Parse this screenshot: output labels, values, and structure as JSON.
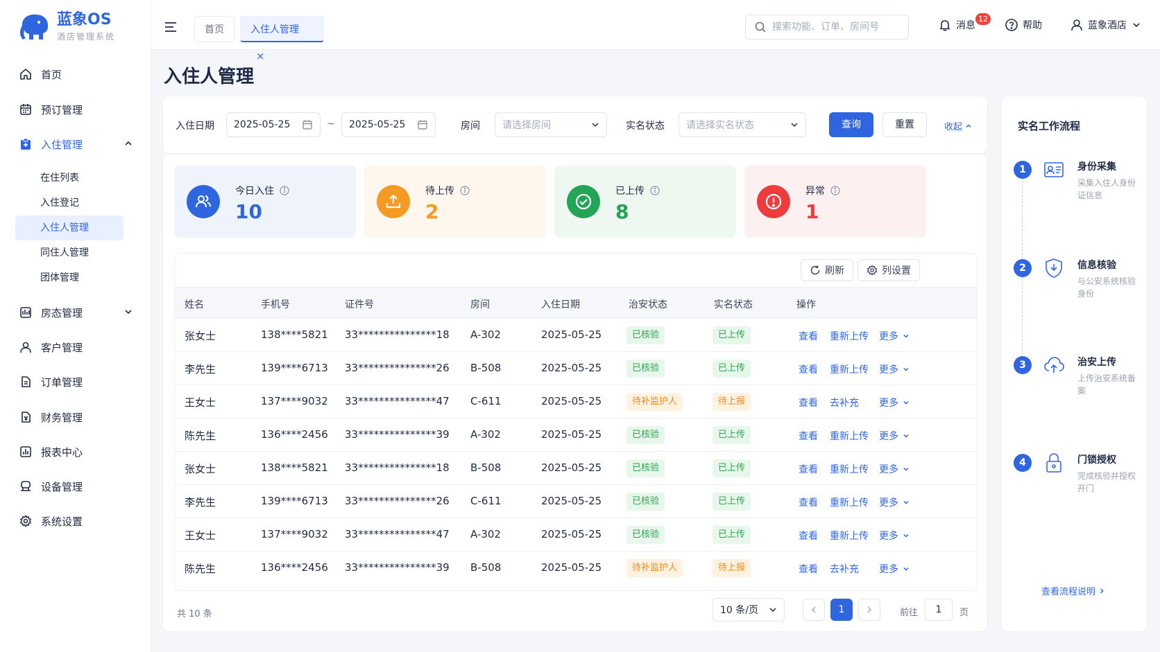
{
  "app": {
    "name": "蓝象OS",
    "subtitle": "酒店管理系统"
  },
  "sidebar": {
    "items": [
      {
        "label": "首页",
        "icon": "home-icon"
      },
      {
        "label": "预订管理",
        "icon": "calendar-icon"
      },
      {
        "label": "入住管理",
        "icon": "checkin-icon",
        "expanded": true
      },
      {
        "label": "房态管理",
        "icon": "room-icon"
      },
      {
        "label": "客户管理",
        "icon": "user-icon"
      },
      {
        "label": "订单管理",
        "icon": "order-icon"
      },
      {
        "label": "财务管理",
        "icon": "finance-icon"
      },
      {
        "label": "报表中心",
        "icon": "report-icon"
      },
      {
        "label": "设备管理",
        "icon": "device-icon"
      },
      {
        "label": "系统设置",
        "icon": "gear-icon"
      }
    ],
    "sub_items": [
      "在住列表",
      "入住登记",
      "入住人管理",
      "同住人管理",
      "团体管理"
    ],
    "active_sub": "入住人管理"
  },
  "topbar": {
    "tabs": [
      {
        "label": "首页"
      },
      {
        "label": "入住人管理",
        "active": true
      }
    ],
    "search_placeholder": "搜索功能、订单、房间号",
    "messages_label": "消息",
    "messages_count": "12",
    "help_label": "帮助",
    "user_label": "蓝象酒店"
  },
  "page": {
    "title": "入住人管理"
  },
  "filter": {
    "date_label": "入住日期",
    "date_start": "2025-05-25",
    "date_sep": "~",
    "date_end": "2025-05-25",
    "room_label": "房间",
    "room_placeholder": "请选择房间",
    "status_label": "实名状态",
    "status_placeholder": "请选择实名状态",
    "query_label": "查询",
    "reset_label": "重置",
    "collapse_label": "收起"
  },
  "stats": [
    {
      "label": "今日入住",
      "value": "10",
      "color": "#2f66e0",
      "bg": "#eef3fc",
      "icon": "users-icon"
    },
    {
      "label": "待上传",
      "value": "2",
      "color": "#f59a23",
      "bg": "#fff7ee",
      "icon": "upload-icon"
    },
    {
      "label": "已上传",
      "value": "8",
      "color": "#22a556",
      "bg": "#eef8f1",
      "icon": "check-circle-icon"
    },
    {
      "label": "异常",
      "value": "1",
      "color": "#ee3b3b",
      "bg": "#fdf0f0",
      "icon": "alert-icon"
    }
  ],
  "table": {
    "refresh_label": "刷新",
    "columns_label": "列设置",
    "headers": [
      "姓名",
      "手机号",
      "证件号",
      "房间",
      "入住日期",
      "治安状态",
      "实名状态",
      "操作"
    ],
    "rows": [
      {
        "name": "张女士",
        "phone": "138****5821",
        "id": "33***************18",
        "room": "A-302",
        "date": "2025-05-25",
        "security": "已核验",
        "realname": "已上传",
        "act2": "重新上传",
        "more": "更多",
        "view": "查看",
        "ok": true
      },
      {
        "name": "李先生",
        "phone": "139****6713",
        "id": "33***************26",
        "room": "B-508",
        "date": "2025-05-25",
        "security": "已核验",
        "realname": "已上传",
        "act2": "重新上传",
        "more": "更多",
        "view": "查看",
        "ok": true
      },
      {
        "name": "王女士",
        "phone": "137****9032",
        "id": "33***************47",
        "room": "C-611",
        "date": "2025-05-25",
        "security": "待补监护人",
        "realname": "待上报",
        "act2": "去补充",
        "more": "更多",
        "view": "查看",
        "ok": false
      },
      {
        "name": "陈先生",
        "phone": "136****2456",
        "id": "33***************39",
        "room": "A-302",
        "date": "2025-05-25",
        "security": "已核验",
        "realname": "已上传",
        "act2": "重新上传",
        "more": "更多",
        "view": "查看",
        "ok": true
      },
      {
        "name": "张女士",
        "phone": "138****5821",
        "id": "33***************18",
        "room": "B-508",
        "date": "2025-05-25",
        "security": "已核验",
        "realname": "已上传",
        "act2": "重新上传",
        "more": "更多",
        "view": "查看",
        "ok": true
      },
      {
        "name": "李先生",
        "phone": "139****6713",
        "id": "33***************26",
        "room": "C-611",
        "date": "2025-05-25",
        "security": "已核验",
        "realname": "已上传",
        "act2": "重新上传",
        "more": "更多",
        "view": "查看",
        "ok": true
      },
      {
        "name": "王女士",
        "phone": "137****9032",
        "id": "33***************47",
        "room": "A-302",
        "date": "2025-05-25",
        "security": "已核验",
        "realname": "已上传",
        "act2": "重新上传",
        "more": "更多",
        "view": "查看",
        "ok": true
      },
      {
        "name": "陈先生",
        "phone": "136****2456",
        "id": "33***************39",
        "room": "B-508",
        "date": "2025-05-25",
        "security": "待补监护人",
        "realname": "待上报",
        "act2": "去补充",
        "more": "更多",
        "view": "查看",
        "ok": false
      }
    ]
  },
  "pagination": {
    "total": "共 10 条",
    "page_size": "10 条/页",
    "current": "1",
    "goto_label": "前往",
    "goto_value": "1",
    "page_suffix": "页"
  },
  "workflow": {
    "title": "实名工作流程",
    "steps": [
      {
        "num": "1",
        "title": "身份采集",
        "desc": "采集入住人身份证信息",
        "icon": "id-card-icon"
      },
      {
        "num": "2",
        "title": "信息核验",
        "desc": "与公安系统核验身份",
        "icon": "shield-check-icon"
      },
      {
        "num": "3",
        "title": "治安上传",
        "desc": "上传治安系统备案",
        "icon": "cloud-upload-icon"
      },
      {
        "num": "4",
        "title": "门锁授权",
        "desc": "完成核验并授权开门",
        "icon": "lock-icon"
      }
    ],
    "link_label": "查看流程说明"
  }
}
